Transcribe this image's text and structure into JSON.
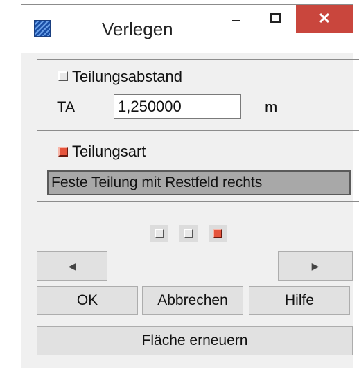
{
  "window": {
    "title": "Verlegen",
    "close_glyph": "✕"
  },
  "spacing_group": {
    "label": "Teilungsabstand",
    "field_label": "TA",
    "field_value": "1,250000",
    "unit": "m"
  },
  "type_group": {
    "label": "Teilungsart",
    "selected": "Feste Teilung mit Restfeld rechts"
  },
  "page_indicator": {
    "total": 3,
    "active": 3
  },
  "nav": {
    "prev": "◀",
    "next": "▶"
  },
  "buttons": {
    "ok": "OK",
    "cancel": "Abbrechen",
    "help": "Hilfe",
    "refresh": "Fläche erneuern"
  },
  "colors": {
    "accent_red": "#e5543c",
    "close_red": "#c9463d",
    "dropdown_gray": "#a8a8a8"
  }
}
